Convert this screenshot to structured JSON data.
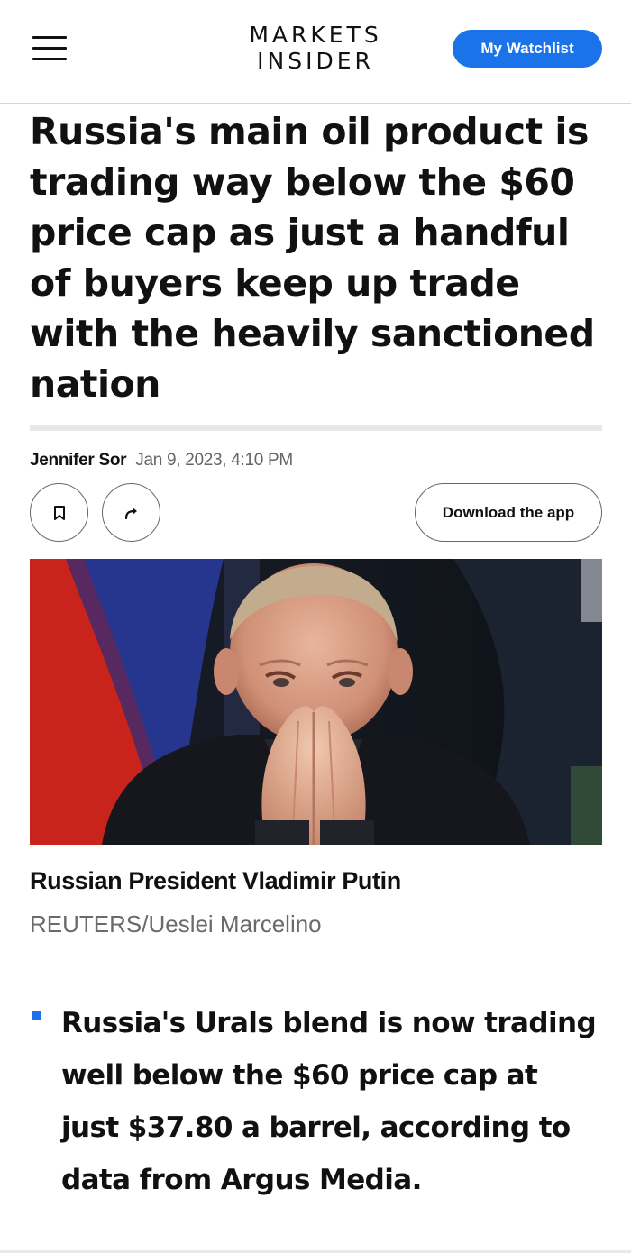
{
  "header": {
    "logo_line1": "MARKETS",
    "logo_line2": "INSIDER",
    "watchlist_label": "My Watchlist",
    "accent_color": "#1a73e8"
  },
  "article": {
    "headline": "Russia's main oil product is trading way below the $60 price cap as just a handful of buyers keep up trade with the heavily sanctioned nation",
    "author": "Jennifer Sor",
    "date": "Jan 9, 2023, 4:10 PM",
    "actions": {
      "bookmark_icon": "bookmark-icon",
      "share_icon": "share-arrow-icon",
      "download_label": "Download the app"
    },
    "image": {
      "caption": "Russian President Vladimir Putin",
      "credit": "REUTERS/Ueslei Marcelino"
    },
    "key_points": [
      "Russia's Urals blend is now trading well below the $60 price cap at just $37.80 a barrel, according to data from Argus Media."
    ]
  }
}
